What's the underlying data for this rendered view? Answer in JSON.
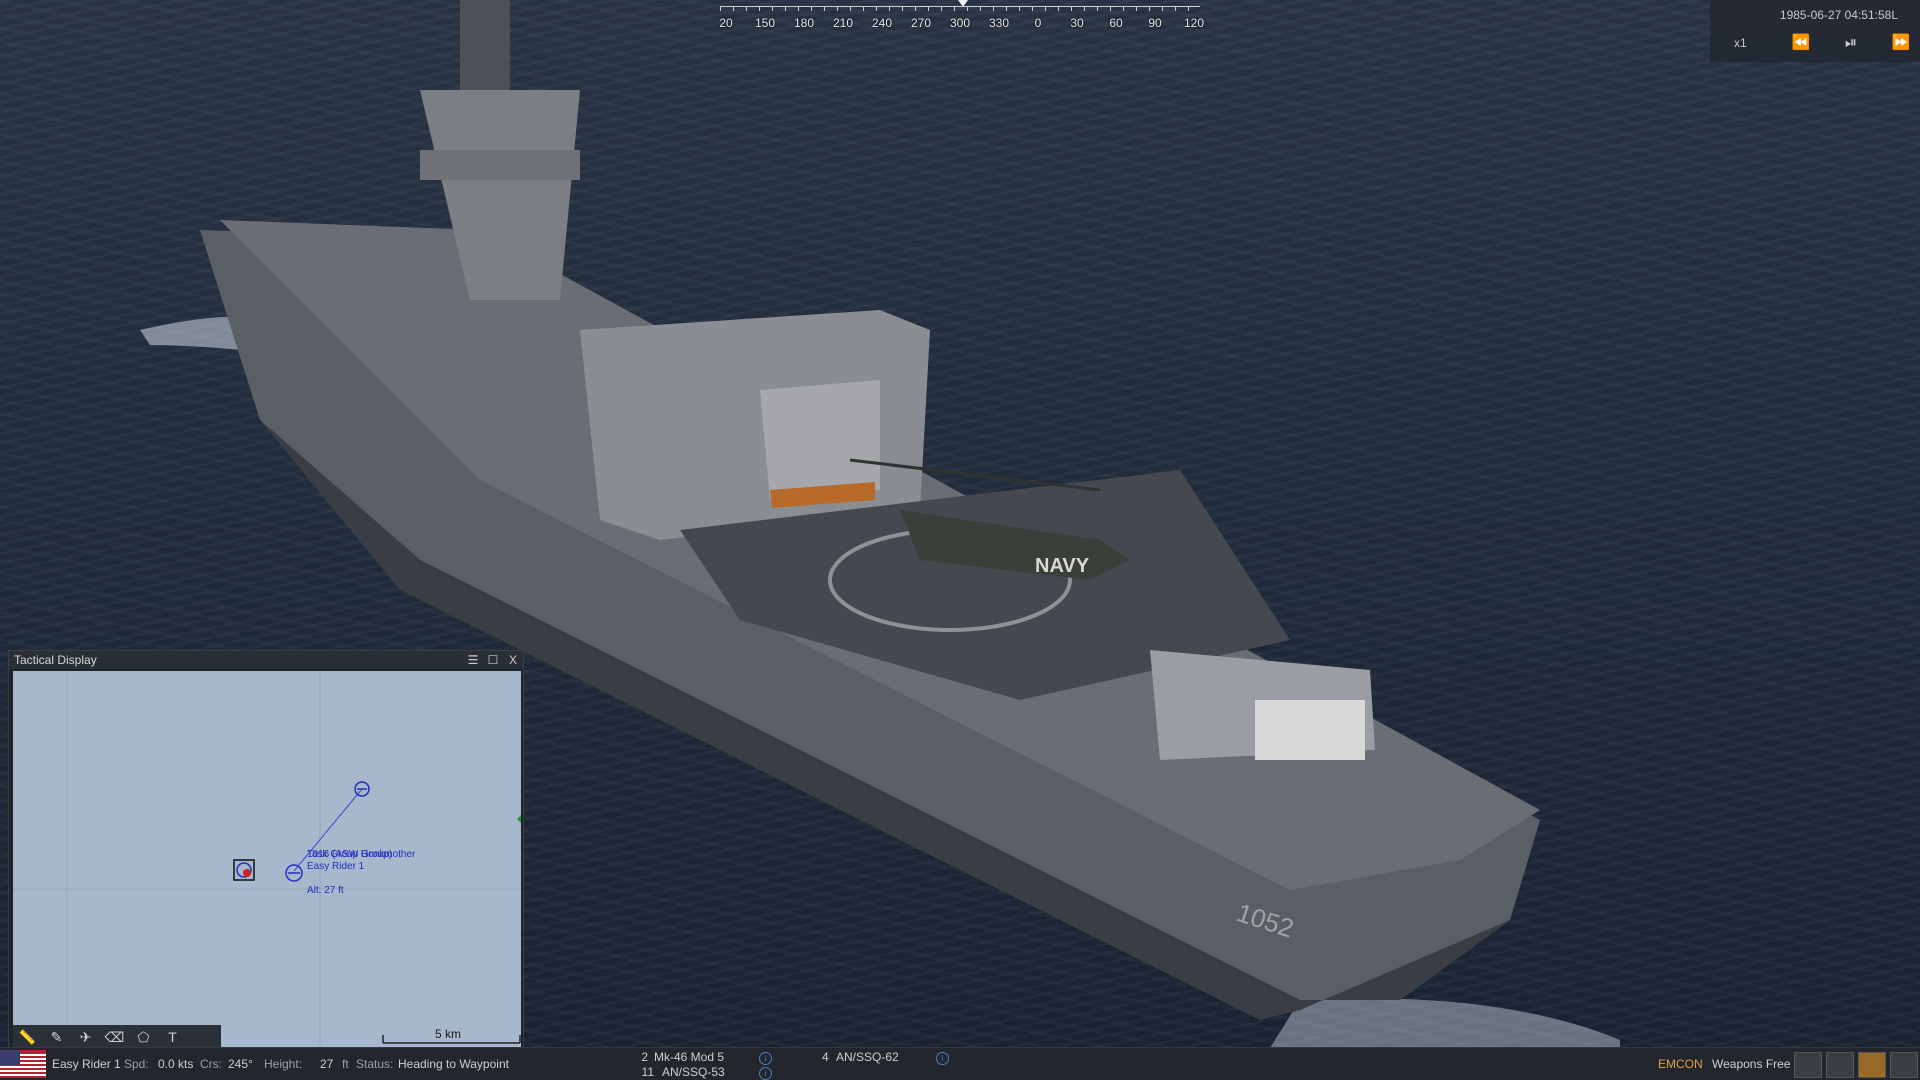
{
  "compass": {
    "labels": [
      "20",
      "150",
      "180",
      "210",
      "240",
      "270",
      "300",
      "330",
      "0",
      "30",
      "60",
      "90",
      "120"
    ]
  },
  "time_control": {
    "datetime": "1985-06-27 04:51:58L",
    "speed": "x1",
    "rewind_icon": "rewind-icon",
    "play_pause_icon": "play-pause-icon",
    "fast_forward_icon": "fast-forward-icon"
  },
  "ship": {
    "hull_number": "1052",
    "helicopter_marking": "NAVY"
  },
  "tactical_display": {
    "title": "Tactical Display",
    "menu_icon": "menu-icon",
    "maximize_icon": "maximize-icon",
    "close_label": "X",
    "unit_label_1": "1016 (ASW Group)",
    "unit_label_2": "Easy Rider 1",
    "unit_label_3": "Alt: 27 ft",
    "waypoint_label": "Task Group Honkmother",
    "scale_label": "5 km",
    "tools": [
      "ruler-icon",
      "pencil-icon",
      "airplane-icon",
      "eraser-icon",
      "polygon-icon",
      "T"
    ]
  },
  "status_bar": {
    "flag": "us-flag",
    "unit_name": "Easy Rider 1",
    "spd_label": "Spd:",
    "spd_value": "0.0 kts",
    "crs_label": "Crs:",
    "crs_value": "245°",
    "height_label": "Height:",
    "height_value": "27",
    "height_unit": "ft",
    "status_label": "Status:",
    "status_value": "Heading to Waypoint",
    "weapons": [
      {
        "count": "2",
        "name": "Mk-46 Mod 5"
      },
      {
        "count": "11",
        "name": "AN/SSQ-53"
      },
      {
        "count": "4",
        "name": "AN/SSQ-62"
      }
    ],
    "emcon": "EMCON",
    "weapons_state": "Weapons Free",
    "buttons": [
      "filter-icon",
      "list-icon",
      "grid-icon",
      "camera-icon"
    ]
  }
}
